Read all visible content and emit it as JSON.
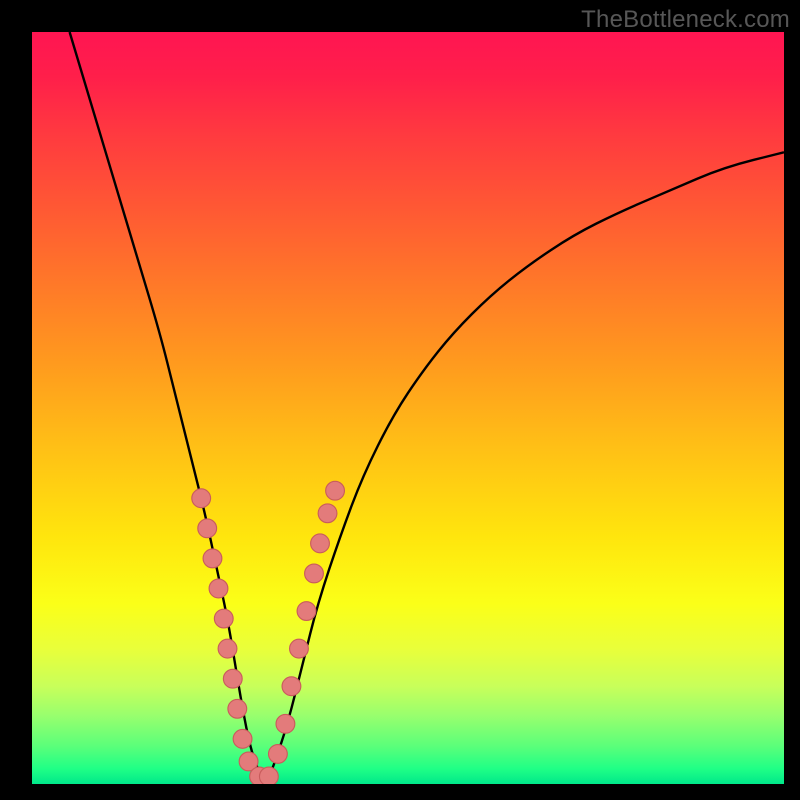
{
  "watermark": "TheBottleneck.com",
  "colors": {
    "frame": "#000000",
    "curve": "#000000",
    "dot_fill": "#e37b7b",
    "dot_stroke": "#c95c5c",
    "gradient_top": "#ff1552",
    "gradient_bottom": "#00e88a"
  },
  "chart_data": {
    "type": "line",
    "title": "",
    "xlabel": "",
    "ylabel": "",
    "xlim": [
      0,
      100
    ],
    "ylim": [
      0,
      100
    ],
    "series": [
      {
        "name": "bottleneck-curve",
        "x": [
          5,
          8,
          11,
          14,
          17,
          19,
          21,
          23,
          24.5,
          26,
          27,
          28,
          29,
          30,
          31,
          32,
          34,
          36,
          38,
          41,
          44,
          48,
          52,
          56,
          61,
          66,
          72,
          78,
          85,
          92,
          100
        ],
        "y": [
          100,
          90,
          80,
          70,
          60,
          52,
          44,
          36,
          29,
          22,
          16,
          10,
          5,
          2,
          0,
          2,
          8,
          16,
          24,
          33,
          41,
          49,
          55,
          60,
          65,
          69,
          73,
          76,
          79,
          82,
          84
        ]
      }
    ],
    "dots": {
      "name": "highlighted-points",
      "x": [
        22.5,
        23.3,
        24.0,
        24.8,
        25.5,
        26.0,
        26.7,
        27.3,
        28.0,
        28.8,
        30.2,
        31.5,
        32.7,
        33.7,
        34.5,
        35.5,
        36.5,
        37.5,
        38.3,
        39.3,
        40.3
      ],
      "y": [
        38,
        34,
        30,
        26,
        22,
        18,
        14,
        10,
        6,
        3,
        1,
        1,
        4,
        8,
        13,
        18,
        23,
        28,
        32,
        36,
        39
      ]
    }
  }
}
